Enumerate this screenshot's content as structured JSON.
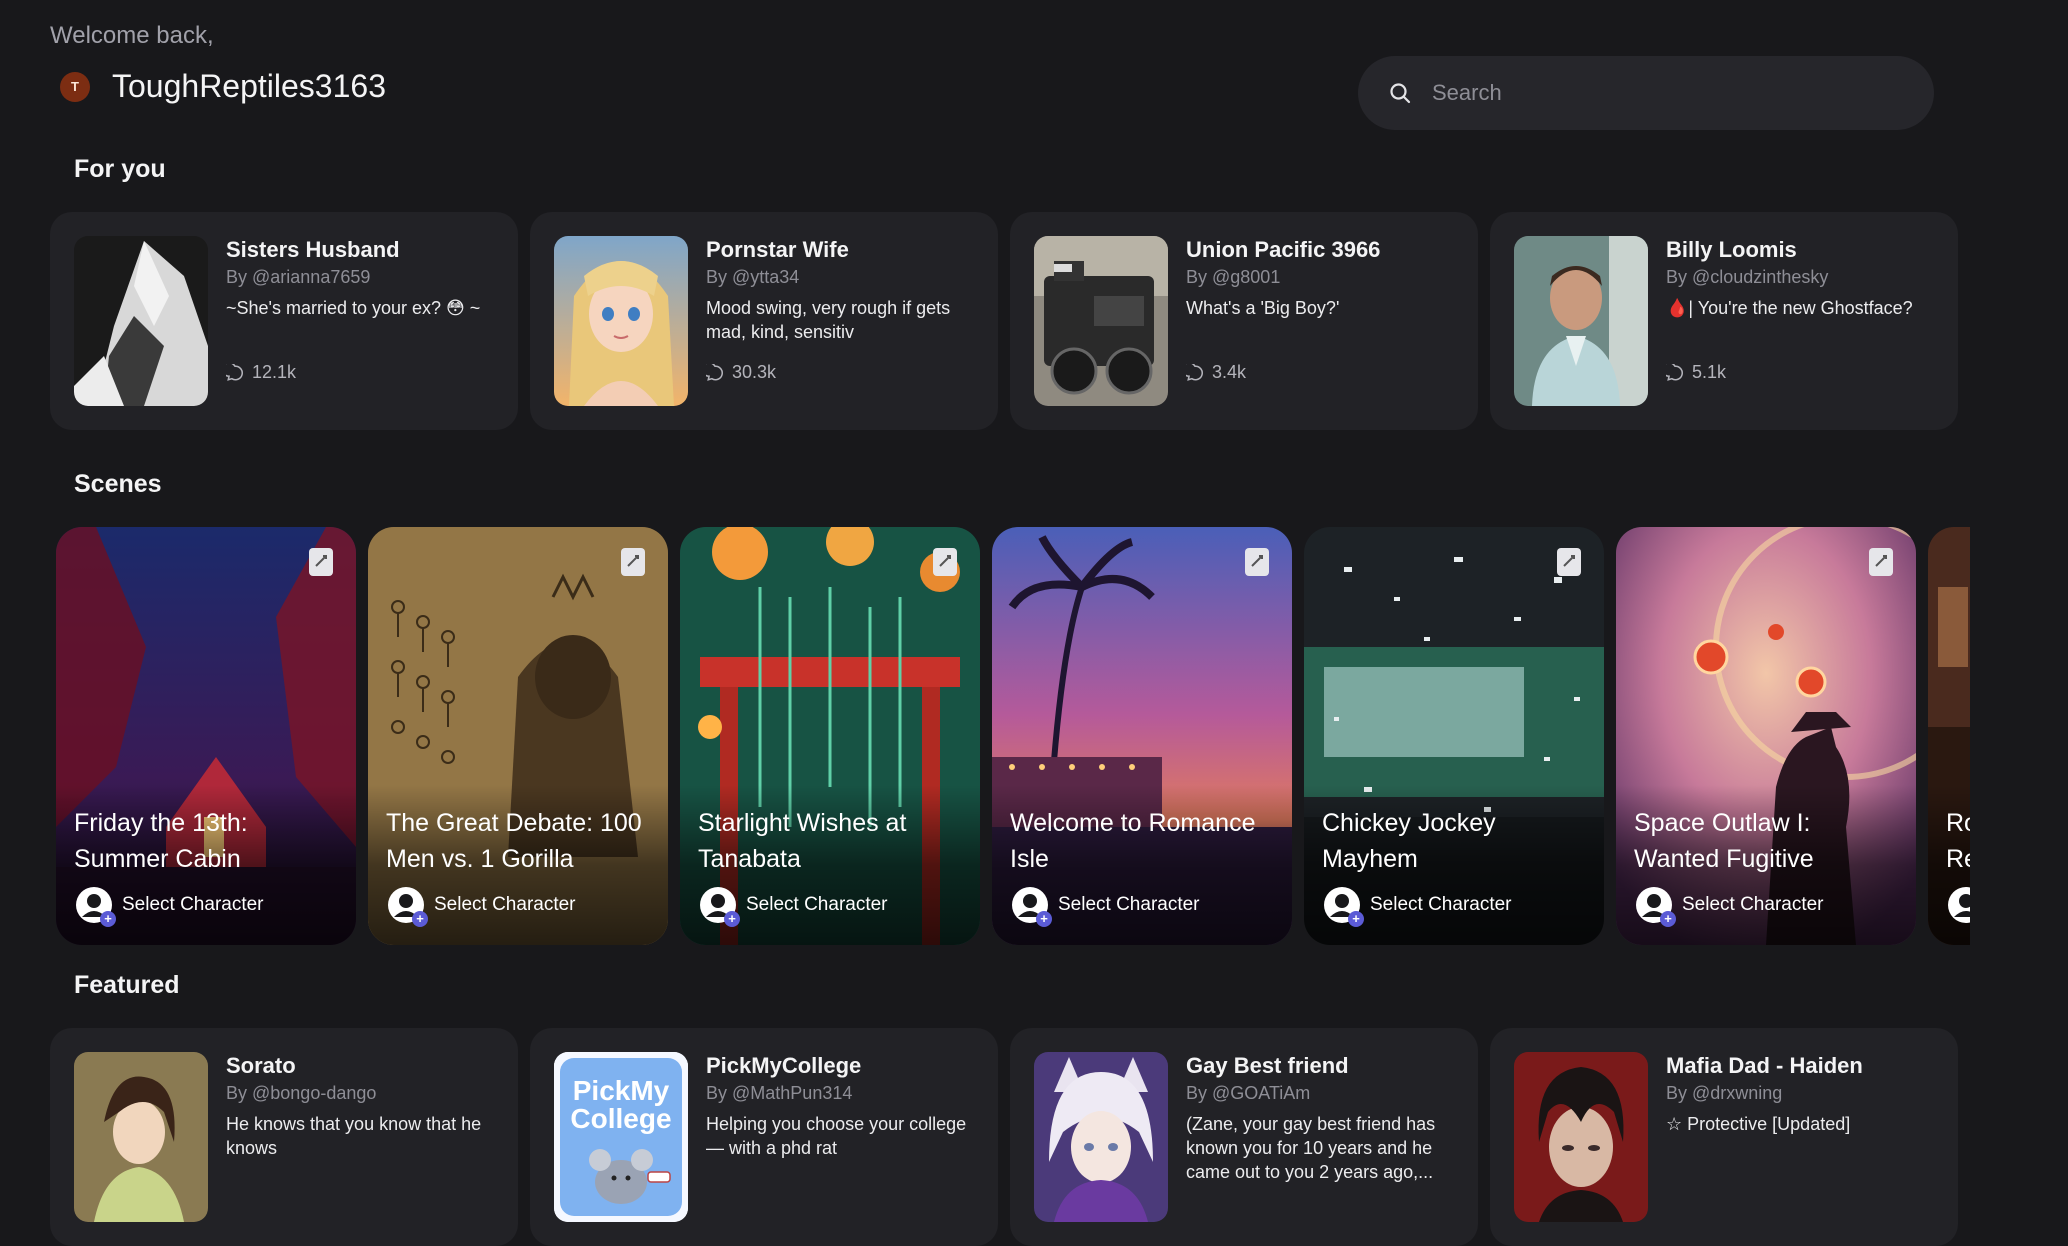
{
  "header": {
    "welcome": "Welcome back,",
    "avatar_initial": "T",
    "username": "ToughReptiles3163",
    "search_placeholder": "Search"
  },
  "sections": {
    "for_you": "For you",
    "scenes": "Scenes",
    "featured": "Featured"
  },
  "for_you": [
    {
      "name": "Sisters Husband",
      "author": "By @arianna7659",
      "desc": "~She's married to your ex? 😳 ~",
      "stats": "12.1k"
    },
    {
      "name": "Pornstar Wife",
      "author": "By @ytta34",
      "desc": "Mood swing, very rough if gets mad, kind, sensitiv",
      "stats": "30.3k"
    },
    {
      "name": "Union Pacific 3966",
      "author": "By @g8001",
      "desc": "What's a 'Big Boy?'",
      "stats": "3.4k"
    },
    {
      "name": "Billy Loomis",
      "author": "By @cloudzinthesky",
      "desc": "🩸| You're the new Ghostface?",
      "stats": "5.1k"
    }
  ],
  "scenes": [
    {
      "title": "Friday the 13th: Summer Cabin",
      "action": "Select Character"
    },
    {
      "title": "The Great Debate: 100 Men vs. 1 Gorilla",
      "action": "Select Character"
    },
    {
      "title": "Starlight Wishes at Tanabata",
      "action": "Select Character"
    },
    {
      "title": "Welcome to Romance Isle",
      "action": "Select Character"
    },
    {
      "title": "Chickey Jockey Mayhem",
      "action": "Select Character"
    },
    {
      "title": "Space Outlaw I: Wanted Fugitive",
      "action": "Select Character"
    },
    {
      "title": "Ro Re",
      "action": ""
    }
  ],
  "featured": [
    {
      "name": "Sorato",
      "author": "By @bongo-dango",
      "desc": "He knows that you know that he knows"
    },
    {
      "name": "PickMyCollege",
      "author": "By @MathPun314",
      "desc": "Helping you choose your college — with a phd rat",
      "logo": "PickMy College"
    },
    {
      "name": "Gay Best friend",
      "author": "By @GOATiAm",
      "desc": "(Zane, your gay best friend has known you for 10 years and he came out to you 2 years ago,..."
    },
    {
      "name": "Mafia Dad - Haiden",
      "author": "By @drxwning",
      "desc": "☆ Protective [Updated]"
    }
  ]
}
